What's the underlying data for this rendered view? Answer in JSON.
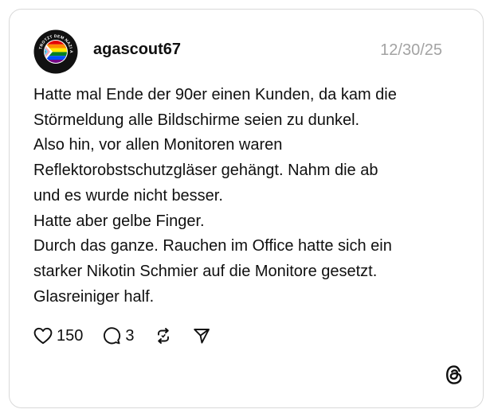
{
  "post": {
    "username": "agascout67",
    "date": "12/30/25",
    "avatar_text": "FREIBURG TROTZT DEM NAZI AUFSTAND",
    "lines": [
      "Hatte mal Ende der 90er einen Kunden, da kam die",
      "Störmeldung alle Bildschirme seien zu dunkel.",
      "Also hin, vor allen Monitoren waren",
      "Reflektorobstschutzgläser gehängt. Nahm die ab",
      "und es wurde nicht besser.",
      "Hatte aber gelbe Finger.",
      "Durch das ganze. Rauchen im Office hatte sich ein",
      "starker Nikotin Schmier auf die Monitore gesetzt.",
      "Glasreiniger half."
    ]
  },
  "actions": {
    "likes": "150",
    "replies": "3"
  },
  "icons": {
    "like": "heart-icon",
    "reply": "comment-icon",
    "repost": "repost-icon",
    "share": "send-icon",
    "brand": "threads-logo-icon"
  },
  "colors": {
    "text": "#101010",
    "muted": "#a3a3a3",
    "border": "#d9d9d9"
  }
}
